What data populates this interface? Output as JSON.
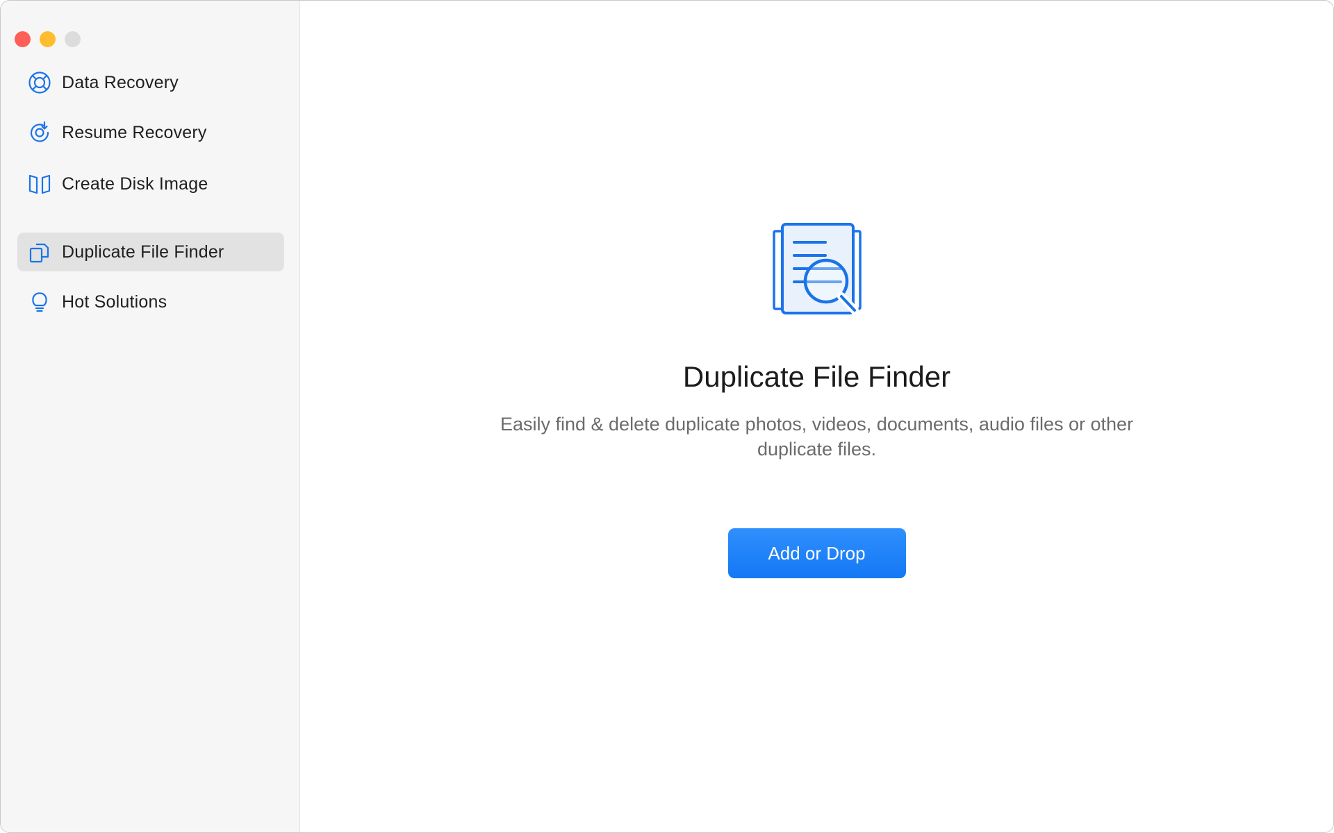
{
  "window": {
    "traffic_lights": [
      {
        "name": "close",
        "color": "#fe5f57"
      },
      {
        "name": "minimize",
        "color": "#febc2e"
      },
      {
        "name": "zoom",
        "color": "#dcdcdc"
      }
    ]
  },
  "sidebar": {
    "items": [
      {
        "label": "Data Recovery",
        "icon": "lifebuoy-icon",
        "active": false
      },
      {
        "label": "Resume Recovery",
        "icon": "resume-refresh-icon",
        "active": false
      },
      {
        "label": "Create Disk Image",
        "icon": "disk-image-icon",
        "active": false
      },
      {
        "label": "Duplicate File Finder",
        "icon": "duplicate-files-icon",
        "active": true
      },
      {
        "label": "Hot Solutions",
        "icon": "lightbulb-icon",
        "active": false
      }
    ],
    "accent": "#1a73e8",
    "active_bg": "#e2e2e2"
  },
  "main": {
    "hero_icon": "document-search-icon",
    "title": "Duplicate File Finder",
    "description": "Easily find & delete duplicate photos, videos, documents, audio files or other duplicate files.",
    "button_label": "Add or Drop",
    "button_color": "#1478f5"
  }
}
